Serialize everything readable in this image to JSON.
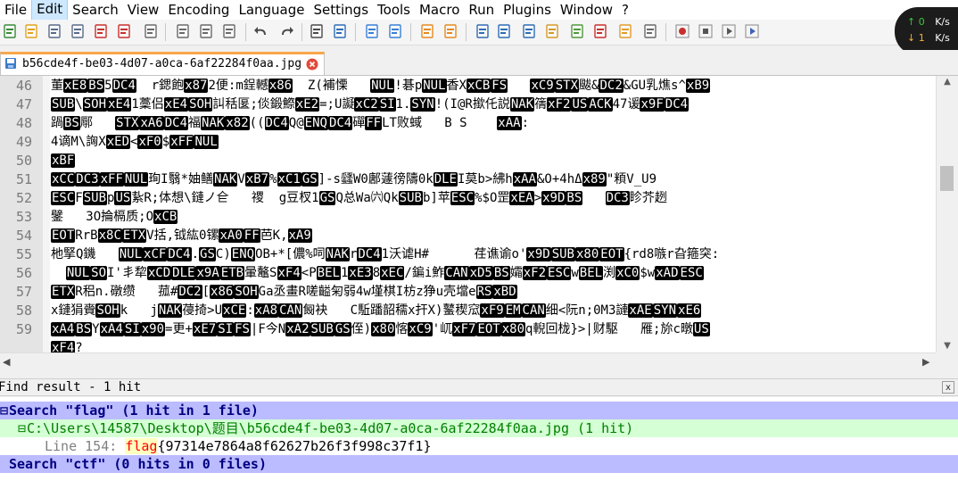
{
  "menu": [
    "File",
    "Edit",
    "Search",
    "View",
    "Encoding",
    "Language",
    "Settings",
    "Tools",
    "Macro",
    "Run",
    "Plugins",
    "Window",
    "?"
  ],
  "toolbar": {
    "icons": [
      "new-file",
      "open-file",
      "save",
      "save-all",
      "close",
      "close-all",
      "print",
      "cut",
      "copy",
      "paste",
      "undo",
      "redo",
      "find",
      "replace",
      "zoom-in",
      "zoom-out",
      "sync-vertical",
      "sync-horizontal",
      "word-wrap",
      "show-all-chars",
      "indent-guide",
      "user-language",
      "doc-map",
      "function-list",
      "folder-workspace",
      "monitoring",
      "record-macro",
      "stop-record",
      "play-macro",
      "run-macro-multiple"
    ]
  },
  "net_speed": {
    "up_value": "0",
    "up_unit": "K/s",
    "down_value": "1",
    "down_unit": "K/s"
  },
  "tab": {
    "filename": "b56cde4f-be03-4d07-a0ca-6af22284f0aa.jpg"
  },
  "editor": {
    "lines": [
      {
        "num": "46",
        "segs": [
          [
            "t",
            "董"
          ],
          [
            "c",
            "xE8"
          ],
          [
            "c",
            "BS"
          ],
          [
            "t",
            "5"
          ],
          [
            "c",
            "DC4"
          ],
          [
            "t",
            "  r鍶飽"
          ],
          [
            "c",
            "x87"
          ],
          [
            "t",
            "2便:m鋥轗"
          ],
          [
            "c",
            "x86"
          ],
          [
            "t",
            "  Z(補慄   "
          ],
          [
            "c",
            "NUL"
          ],
          [
            "t",
            "!碁p"
          ],
          [
            "c",
            "NUL"
          ],
          [
            "t",
            "香X"
          ],
          [
            "c",
            "xCB"
          ],
          [
            "c",
            "FS"
          ],
          [
            "t",
            "   "
          ],
          [
            "c",
            "xC9"
          ],
          [
            "c",
            "STX"
          ],
          [
            "t",
            "颰&"
          ],
          [
            "c",
            "DC2"
          ],
          [
            "t",
            "&GU乳燋s^"
          ],
          [
            "c",
            "xB9"
          ]
        ]
      },
      {
        "num": "47",
        "segs": [
          [
            "c",
            "SUB"
          ],
          [
            "t",
            "\\"
          ],
          [
            "c",
            "SOH"
          ],
          [
            "c",
            "xE4"
          ],
          [
            "t",
            "1藳侣"
          ],
          [
            "c",
            "xE4"
          ],
          [
            "c",
            "SOH"
          ],
          [
            "t",
            "訆秳匽;倓鍛鰶"
          ],
          [
            "c",
            "xE2"
          ],
          [
            "t",
            "=;U譺"
          ],
          [
            "c",
            "xC2"
          ],
          [
            "c",
            "SI"
          ],
          [
            "t",
            "1."
          ],
          [
            "c",
            "SYN"
          ],
          [
            "t",
            "!(I@R撳仛説"
          ],
          [
            "c",
            "NAK"
          ],
          [
            "t",
            "篟"
          ],
          [
            "c",
            "xF2"
          ],
          [
            "c",
            "US"
          ],
          [
            "c",
            "ACK"
          ],
          [
            "t",
            "47谖"
          ],
          [
            "c",
            "x9F"
          ],
          [
            "c",
            "DC4"
          ]
        ]
      },
      {
        "num": "48",
        "segs": [
          [
            "t",
            "踻"
          ],
          [
            "c",
            "BS"
          ],
          [
            "t",
            "鄏   "
          ],
          [
            "c",
            "STX"
          ],
          [
            "c",
            "xA6"
          ],
          [
            "c",
            "DC4"
          ],
          [
            "t",
            "福"
          ],
          [
            "c",
            "NAK"
          ],
          [
            "c",
            "x82"
          ],
          [
            "t",
            "(("
          ],
          [
            "c",
            "DC4"
          ],
          [
            "t",
            "Q@"
          ],
          [
            "c",
            "ENQ"
          ],
          [
            "c",
            "DC4"
          ],
          [
            "t",
            "磾"
          ],
          [
            "c",
            "FF"
          ],
          [
            "t",
            "LT败蜮   B S    "
          ],
          [
            "c",
            "xAA"
          ],
          [
            "t",
            ":"
          ]
        ]
      },
      {
        "num": "49",
        "segs": [
          [
            "t",
            "4谪M\\詾X"
          ],
          [
            "c",
            "xED"
          ],
          [
            "t",
            "<"
          ],
          [
            "c",
            "xF0"
          ],
          [
            "t",
            "$"
          ],
          [
            "c",
            "xFF"
          ],
          [
            "c",
            "NUL"
          ]
        ]
      },
      {
        "num": "50",
        "segs": [
          [
            "c",
            "xBF"
          ]
        ]
      },
      {
        "num": "51",
        "segs": [
          [
            "c",
            "xCC"
          ],
          [
            "c",
            "DC3"
          ],
          [
            "c",
            "xFF"
          ],
          [
            "c",
            "NUL"
          ],
          [
            "t",
            "珣I翳*妯鳝"
          ],
          [
            "c",
            "NAK"
          ],
          [
            "t",
            "V"
          ],
          [
            "c",
            "xB7"
          ],
          [
            "t",
            "%"
          ],
          [
            "c",
            "xC1"
          ],
          [
            "c",
            "GS"
          ],
          [
            "t",
            "]-s瓥W0鄌蘧徬隯0k"
          ],
          [
            "c",
            "DLE"
          ],
          [
            "t",
            "I莫b>紼h"
          ],
          [
            "c",
            "xAA"
          ],
          [
            "t",
            "&O+4hΔ"
          ],
          [
            "c",
            "x89"
          ],
          [
            "t",
            "\"頪V_U9      "
          ]
        ]
      },
      {
        "num": "52",
        "segs": [
          [
            "c",
            "ESC"
          ],
          [
            "t",
            "F"
          ],
          [
            "c",
            "SUB"
          ],
          [
            "t",
            "p"
          ],
          [
            "c",
            "US"
          ],
          [
            "t",
            "紥R;体想\\鏈ノ仺   禝  g豆杈1"
          ],
          [
            "c",
            "GS"
          ],
          [
            "t",
            "Q总Wa㈥Qk"
          ],
          [
            "c",
            "SUB"
          ],
          [
            "t",
            "b]苹"
          ],
          [
            "c",
            "ESC"
          ],
          [
            "t",
            "%$O罡"
          ],
          [
            "c",
            "xEA"
          ],
          [
            "t",
            ">"
          ],
          [
            "c",
            "x9D"
          ],
          [
            "c",
            "BS"
          ],
          [
            "t",
            "   "
          ],
          [
            "c",
            "DC3"
          ],
          [
            "t",
            "眕芥趔"
          ]
        ]
      },
      {
        "num": "53",
        "segs": [
          [
            "t",
            "鐾   3O掄槅质;O"
          ],
          [
            "c",
            "xCB"
          ]
        ]
      },
      {
        "num": "54",
        "segs": [
          [
            "c",
            "EOT"
          ],
          [
            "t",
            "RrB"
          ],
          [
            "c",
            "x8C"
          ],
          [
            "c",
            "ETX"
          ],
          [
            "t",
            "V括,钺紘0镙"
          ],
          [
            "c",
            "xA0"
          ],
          [
            "c",
            "FF"
          ],
          [
            "t",
            "芭K,"
          ],
          [
            "c",
            "xA9"
          ]
        ]
      },
      {
        "num": "55",
        "segs": [
          [
            "t",
            "杝掔Q鐖   "
          ],
          [
            "c",
            "NUL"
          ],
          [
            "c",
            "xCF"
          ],
          [
            "c",
            "DC4"
          ],
          [
            "t",
            "."
          ],
          [
            "c",
            "GS"
          ],
          [
            "t",
            "C)"
          ],
          [
            "c",
            "ENQ"
          ],
          [
            "t",
            "OB+*[儂%呞"
          ],
          [
            "c",
            "NAK"
          ],
          [
            "t",
            "r"
          ],
          [
            "c",
            "DC4"
          ],
          [
            "t",
            "1沃谑H#      荏谯谕o'"
          ],
          [
            "c",
            "x9D"
          ],
          [
            "c",
            "SUB"
          ],
          [
            "c",
            "x80"
          ],
          [
            "c",
            "EOT"
          ],
          [
            "t",
            "{rd8嗾r旮箍突:"
          ]
        ]
      },
      {
        "num": "56",
        "segs": [
          [
            "t",
            "  "
          ],
          [
            "c",
            "NUL"
          ],
          [
            "c",
            "SO"
          ],
          [
            "t",
            "I'丯犂"
          ],
          [
            "c",
            "xCD"
          ],
          [
            "c",
            "DLE"
          ],
          [
            "c",
            "x9A"
          ],
          [
            "c",
            "ETB"
          ],
          [
            "t",
            "暈鼇S"
          ],
          [
            "c",
            "xF4"
          ],
          [
            "t",
            "<P"
          ],
          [
            "c",
            "BEL"
          ],
          [
            "t",
            "1"
          ],
          [
            "c",
            "xE3"
          ],
          [
            "t",
            "8"
          ],
          [
            "c",
            "xEC"
          ],
          [
            "t",
            "/鍽i鮓"
          ],
          [
            "c",
            "CAN"
          ],
          [
            "c",
            "xD5"
          ],
          [
            "c",
            "BS"
          ],
          [
            "t",
            "孀"
          ],
          [
            "c",
            "xF2"
          ],
          [
            "c",
            "ESC"
          ],
          [
            "t",
            "w"
          ],
          [
            "c",
            "BEL"
          ],
          [
            "t",
            "渕"
          ],
          [
            "c",
            "xC0"
          ],
          [
            "t",
            "$w"
          ],
          [
            "c",
            "xAD"
          ],
          [
            "c",
            "ESC"
          ]
        ]
      },
      {
        "num": "57",
        "segs": [
          [
            "c",
            "ETX"
          ],
          [
            "t",
            "R稆n.礅缵   菰#"
          ],
          [
            "c",
            "DC2"
          ],
          [
            "t",
            "["
          ],
          [
            "c",
            "x86"
          ],
          [
            "c",
            "SOH"
          ],
          [
            "t",
            "Ga丞畫R嗟齸匊弱4w墐棋I枋z狰u壳壋e"
          ],
          [
            "c",
            "RS"
          ],
          [
            "c",
            "xBD"
          ]
        ]
      },
      {
        "num": "58",
        "segs": [
          [
            "t",
            "x鏈狷賫"
          ],
          [
            "c",
            "SOH"
          ],
          [
            "t",
            "k   j"
          ],
          [
            "c",
            "NAK"
          ],
          [
            "t",
            "葠掎>U"
          ],
          [
            "c",
            "xCE"
          ],
          [
            "t",
            ":"
          ],
          [
            "c",
            "xA8"
          ],
          [
            "c",
            "CAN"
          ],
          [
            "t",
            "匓袂   C駈蹯韶穤x扞X)鼜稧窊"
          ],
          [
            "c",
            "xF9"
          ],
          [
            "c",
            "EM"
          ],
          [
            "c",
            "CAN"
          ],
          [
            "t",
            "细<阮n;0M3謰"
          ],
          [
            "c",
            "xAE"
          ],
          [
            "c",
            "SYN"
          ],
          [
            "c",
            "xE6"
          ]
        ]
      },
      {
        "num": "59",
        "segs": [
          [
            "c",
            "xA4"
          ],
          [
            "c",
            "BS"
          ],
          [
            "t",
            "Y"
          ],
          [
            "c",
            "xA4"
          ],
          [
            "c",
            "SI"
          ],
          [
            "c",
            "x90"
          ],
          [
            "t",
            "=更+"
          ],
          [
            "c",
            "xE7"
          ],
          [
            "c",
            "SI"
          ],
          [
            "c",
            "FS"
          ],
          [
            "t",
            "|F今N"
          ],
          [
            "c",
            "xA2"
          ],
          [
            "c",
            "SUB"
          ],
          [
            "c",
            "GS"
          ],
          [
            "t",
            "侄)"
          ],
          [
            "c",
            "x80"
          ],
          [
            "t",
            "愘"
          ],
          [
            "c",
            "xC9"
          ],
          [
            "t",
            "'屼"
          ],
          [
            "c",
            "xF7"
          ],
          [
            "c",
            "EOT"
          ],
          [
            "c",
            "x80"
          ],
          [
            "t",
            "q輗回栊}>|财駆   雁;旀c暾"
          ],
          [
            "c",
            "US"
          ]
        ]
      },
      {
        "num": "",
        "segs": [
          [
            "c",
            "xF4"
          ],
          [
            "t",
            "?"
          ]
        ]
      }
    ]
  },
  "find": {
    "panel_title": "Find result - 1 hit",
    "close_glyph": "x",
    "search1": "Search \"flag\" (1 hit in 1 file)",
    "file_path": "C:\\Users\\14587\\Desktop\\题目\\b56cde4f-be03-4d07-a0ca-6af22284f0aa.jpg (1 hit)",
    "hit_label": "Line 154: ",
    "hit_match": "flag",
    "hit_rest": "{97314e7864a8f62627b26f3f998c37f1}",
    "search2": "Search \"ctf\" (0 hits in 0 files)"
  }
}
